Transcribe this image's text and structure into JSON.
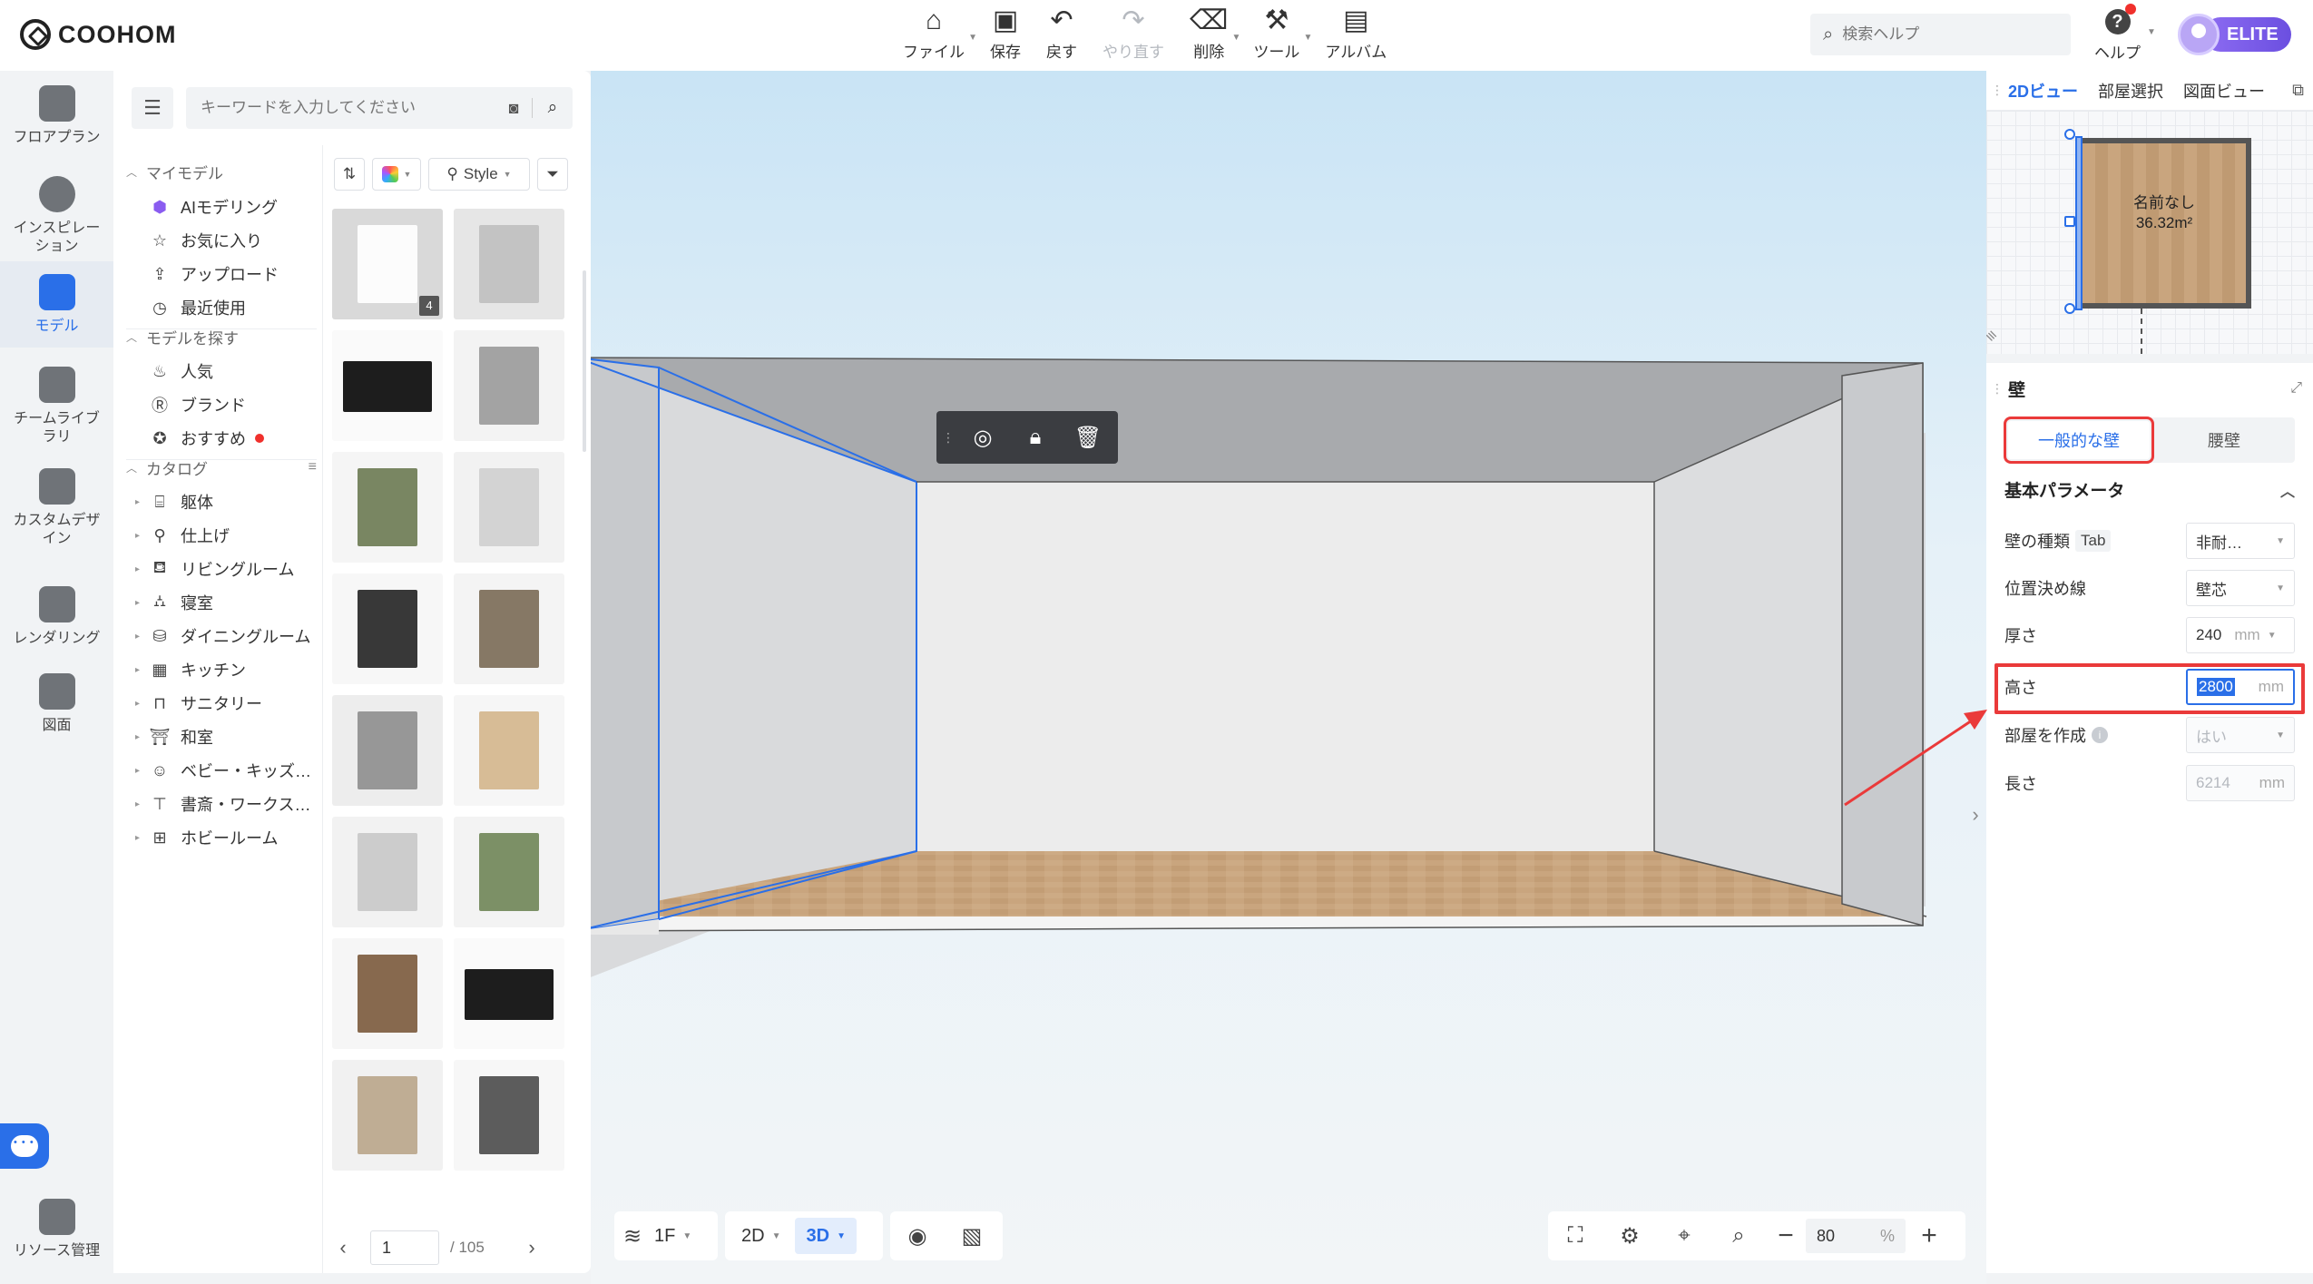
{
  "app": {
    "logo_text": "COOHOM"
  },
  "toolbar": {
    "items": [
      {
        "label": "ファイル",
        "icon": "home-file-icon",
        "caret": true,
        "disabled": false
      },
      {
        "label": "保存",
        "icon": "save-icon",
        "caret": false,
        "disabled": false
      },
      {
        "label": "戻す",
        "icon": "undo-icon",
        "caret": false,
        "disabled": false
      },
      {
        "label": "やり直す",
        "icon": "redo-icon",
        "caret": false,
        "disabled": true
      },
      {
        "label": "削除",
        "icon": "eraser-icon",
        "caret": true,
        "disabled": false
      },
      {
        "label": "ツール",
        "icon": "wrench-icon",
        "caret": true,
        "disabled": false
      },
      {
        "label": "アルバム",
        "icon": "album-icon",
        "caret": false,
        "disabled": false
      }
    ]
  },
  "header": {
    "search_placeholder": "検索ヘルプ",
    "help_label": "ヘルプ",
    "badge_label": "ELITE"
  },
  "leftnav": {
    "items": [
      {
        "label": "フロアプラン",
        "icon": "floorplan-icon",
        "active": false
      },
      {
        "label": "インスピレーション",
        "icon": "lightbulb-icon",
        "active": false
      },
      {
        "label": "モデル",
        "icon": "sofa-icon",
        "active": true
      },
      {
        "label": "チームライブラリ",
        "icon": "crown-icon",
        "active": false
      },
      {
        "label": "カスタムデザイン",
        "icon": "box-icon",
        "active": false
      },
      {
        "label": "レンダリング",
        "icon": "camera-icon",
        "active": false
      },
      {
        "label": "図面",
        "icon": "blueprint-icon",
        "active": false
      },
      {
        "label": "リソース管理",
        "icon": "resource-icon",
        "active": false
      }
    ]
  },
  "model_panel": {
    "search_placeholder": "キーワードを入力してください",
    "sections": {
      "my_models": "マイモデル",
      "find_models": "モデルを探す",
      "catalog": "カタログ"
    },
    "my_models": [
      {
        "label": "AIモデリング",
        "icon": "ai-cube-icon"
      },
      {
        "label": "お気に入り",
        "icon": "star-icon"
      },
      {
        "label": "アップロード",
        "icon": "upload-icon"
      },
      {
        "label": "最近使用",
        "icon": "clock-icon"
      }
    ],
    "find_models": [
      {
        "label": "人気",
        "icon": "flame-icon"
      },
      {
        "label": "ブランド",
        "icon": "brand-icon"
      },
      {
        "label": "おすすめ",
        "icon": "recommend-icon"
      }
    ],
    "catalog": [
      {
        "label": "躯体",
        "icon": "structure-icon"
      },
      {
        "label": "仕上げ",
        "icon": "brush-icon"
      },
      {
        "label": "リビングルーム",
        "icon": "sofa-small-icon"
      },
      {
        "label": "寝室",
        "icon": "bed-icon"
      },
      {
        "label": "ダイニングルーム",
        "icon": "dining-icon"
      },
      {
        "label": "キッチン",
        "icon": "kitchen-icon"
      },
      {
        "label": "サニタリー",
        "icon": "bath-icon"
      },
      {
        "label": "和室",
        "icon": "japanese-room-icon"
      },
      {
        "label": "ベビー・キッズ…",
        "icon": "baby-icon"
      },
      {
        "label": "書斎・ワークス…",
        "icon": "desk-icon"
      },
      {
        "label": "ホビールーム",
        "icon": "game-icon"
      }
    ],
    "filter": {
      "style_label": "Style"
    },
    "thumbnails": [
      {
        "name": "door-white",
        "badge": "4"
      },
      {
        "name": "fridge-silver",
        "badge": ""
      },
      {
        "name": "tv-panel",
        "badge": ""
      },
      {
        "name": "kitchen-counter",
        "badge": ""
      },
      {
        "name": "plant-decor",
        "badge": ""
      },
      {
        "name": "book-stack",
        "badge": ""
      },
      {
        "name": "glass-door",
        "badge": ""
      },
      {
        "name": "reed-diffuser",
        "badge": ""
      },
      {
        "name": "tall-fridge",
        "badge": ""
      },
      {
        "name": "wood-door",
        "badge": ""
      },
      {
        "name": "vanity-sink",
        "badge": ""
      },
      {
        "name": "plant-books",
        "badge": ""
      },
      {
        "name": "sliding-door",
        "badge": ""
      },
      {
        "name": "tv-screen",
        "badge": ""
      },
      {
        "name": "table-clock",
        "badge": ""
      },
      {
        "name": "candle-jar",
        "badge": ""
      }
    ],
    "pager": {
      "current": "1",
      "total": "/ 105"
    }
  },
  "viewport": {
    "floor_label": "1F",
    "view_2d": "2D",
    "view_3d": "3D",
    "zoom_value": "80",
    "zoom_unit": "%"
  },
  "minimap": {
    "tabs": [
      "2Dビュー",
      "部屋選択",
      "図面ビュー"
    ],
    "active_tab": 0,
    "room_name": "名前なし",
    "room_area": "36.32m²"
  },
  "props": {
    "title": "壁",
    "segments": [
      "一般的な壁",
      "腰壁"
    ],
    "active_segment": 0,
    "section_title": "基本パラメータ",
    "rows": [
      {
        "label": "壁の種類",
        "tag": "Tab",
        "value": "非耐…",
        "unit": "",
        "type": "select",
        "disabled": false
      },
      {
        "label": "位置決め線",
        "tag": "",
        "value": "壁芯",
        "unit": "",
        "type": "select",
        "disabled": false
      },
      {
        "label": "厚さ",
        "tag": "",
        "value": "240",
        "unit": "mm",
        "type": "number-select",
        "disabled": false
      },
      {
        "label": "高さ",
        "tag": "",
        "value": "2800",
        "unit": "mm",
        "type": "number",
        "disabled": false,
        "focused": true
      },
      {
        "label": "部屋を作成",
        "tag": "",
        "value": "はい",
        "unit": "",
        "type": "select",
        "disabled": true,
        "info": true
      },
      {
        "label": "長さ",
        "tag": "",
        "value": "6214",
        "unit": "mm",
        "type": "number",
        "disabled": true
      }
    ]
  },
  "colors": {
    "accent": "#2a6fe8",
    "annotation": "#ea3a3a",
    "floor_wood": "#c9a57e"
  }
}
